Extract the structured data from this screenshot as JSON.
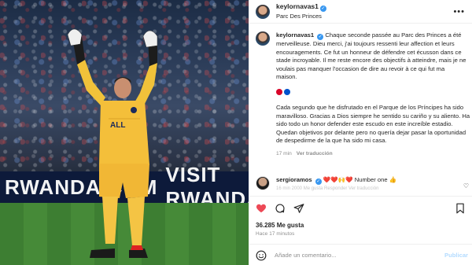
{
  "post": {
    "username": "keylornavas1",
    "location": "Parc Des Princes",
    "banner_text": [
      "RWANDA.COM",
      "VISIT RWANDA"
    ],
    "caption_fr": "Chaque seconde passée au Parc des Princes a été merveilleuse. Dieu merci, j'ai toujours ressenti leur affection et leurs encouragements. Ce fut un honneur de défendre cet écusson dans ce stade incroyable. Il me reste encore des objectifs à atteindre, mais je ne voulais pas manquer l'occasion de dire au revoir à ce qui fut ma maison.",
    "caption_es": "Cada segundo que he disfrutado en el Parque de los Príncipes ha sido maravilloso. Gracias a Dios siempre he sentido su cariño y su aliento. Ha sido todo un honor defender este escudo en este increíble estadio. Quedan objetivos por delante pero no quería dejar pasar la oportunidad de despedirme de la que ha sido mi casa.",
    "caption_time": "17 min",
    "see_translation": "Ver traducción",
    "flag_colors": [
      "#d90429",
      "#0052cc"
    ]
  },
  "comment": {
    "username": "sergioramos",
    "text": "❤️❤️🙌❤️ Number one 👍",
    "meta": "16 min   2000 Me gusta   Responder   Ver traducción"
  },
  "actions": {
    "likes": "36.285 Me gusta",
    "ago": "Hace 17 minutos",
    "add_comment_placeholder": "Añade un comentario...",
    "publish_label": "Publicar",
    "icons": [
      "heart-icon",
      "comment-icon",
      "share-icon",
      "bookmark-icon",
      "emoji-icon"
    ],
    "like_color": "#ed4956"
  }
}
